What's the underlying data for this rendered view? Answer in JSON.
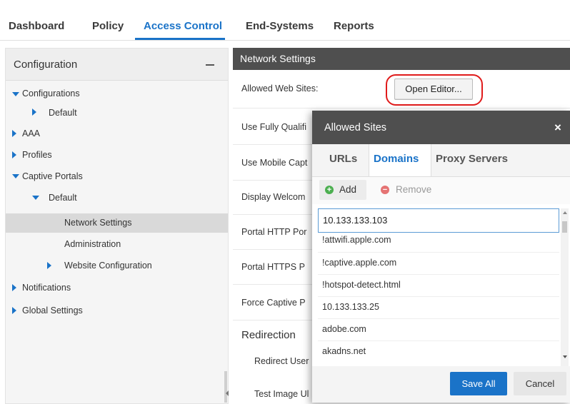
{
  "nav": {
    "tabs": [
      "Dashboard",
      "Policy",
      "Access Control",
      "End-Systems",
      "Reports"
    ],
    "active": "Access Control"
  },
  "sidebar": {
    "title": "Configuration",
    "items": [
      {
        "label": "Configurations"
      },
      {
        "label": "Default"
      },
      {
        "label": "AAA"
      },
      {
        "label": "Profiles"
      },
      {
        "label": "Captive Portals"
      },
      {
        "label": "Default"
      },
      {
        "label": "Network Settings"
      },
      {
        "label": "Administration"
      },
      {
        "label": "Website Configuration"
      },
      {
        "label": "Notifications"
      },
      {
        "label": "Global Settings"
      }
    ]
  },
  "settings": {
    "title": "Network Settings",
    "allowed_label": "Allowed Web Sites:",
    "open_editor": "Open Editor...",
    "rows": [
      "Use Fully Qualifi",
      "Use Mobile Capt",
      "Display Welcom",
      "Portal HTTP Por",
      "Portal HTTPS P",
      "Force Captive P"
    ],
    "redirection": "Redirection",
    "redirect_user": "Redirect User",
    "test_image": "Test Image Ul"
  },
  "modal": {
    "title": "Allowed Sites",
    "close": "×",
    "tabs": [
      "URLs",
      "Domains",
      "Proxy Servers"
    ],
    "active_tab": "Domains",
    "add": "Add",
    "remove": "Remove",
    "input_value": "10.133.133.103",
    "domains": [
      "!attwifi.apple.com",
      "!captive.apple.com",
      "!hotspot-detect.html",
      "10.133.133.25",
      "adobe.com",
      "akadns.net"
    ],
    "save": "Save All",
    "cancel": "Cancel"
  },
  "colors": {
    "accent": "#1a73c8",
    "header_dark": "#4f4f4f",
    "highlight_circle": "#e01b1b",
    "add_icon": "#4caf50",
    "remove_icon": "#e57373"
  }
}
